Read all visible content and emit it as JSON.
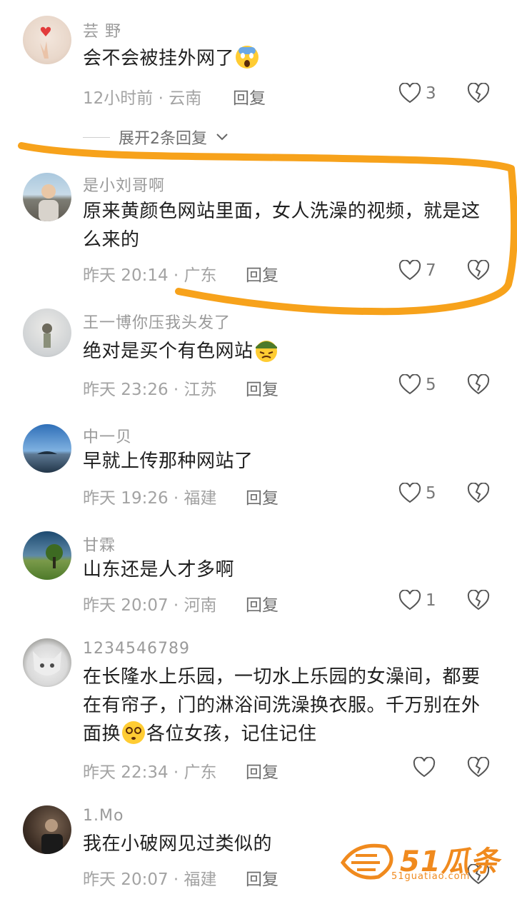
{
  "comments": [
    {
      "username": "芸 野",
      "text": "会不会被挂外网了",
      "time": "12小时前",
      "location": "云南",
      "reply": "回复",
      "likes": "3"
    },
    {
      "username": "是小刘哥啊",
      "text": "原来黄颜色网站里面，女人洗澡的视频，就是这么来的",
      "time": "昨天 20:14",
      "location": "广东",
      "reply": "回复",
      "likes": "7"
    },
    {
      "username": "王一博你压我头发了",
      "text": "绝对是买个有色网站",
      "time": "昨天 23:26",
      "location": "江苏",
      "reply": "回复",
      "likes": "5"
    },
    {
      "username": "中一贝",
      "text": "早就上传那种网站了",
      "time": "昨天 19:26",
      "location": "福建",
      "reply": "回复",
      "likes": "5"
    },
    {
      "username": "甘霖",
      "text": "山东还是人才多啊",
      "time": "昨天 20:07",
      "location": "河南",
      "reply": "回复",
      "likes": "1"
    },
    {
      "username": "1234546789",
      "text_a": "在长隆水上乐园，一切水上乐园的女澡间，都要在有帘子，门的淋浴间洗澡换衣服。千万别在外面换",
      "text_b": "各位女孩，记住记住",
      "time": "昨天 22:34",
      "location": "广东",
      "reply": "回复",
      "likes": ""
    },
    {
      "username": "1.Mo",
      "text": "我在小破网见过类似的",
      "time": "昨天 20:07",
      "location": "福建",
      "reply": "回复",
      "likes": ""
    }
  ],
  "expand_replies": "展开2条回复",
  "separator": "·",
  "icons": {
    "like": "heart-outline-icon",
    "dislike": "broken-heart-icon",
    "expand": "chevron-down-icon"
  },
  "watermark": {
    "brand": "51瓜条",
    "url": "51guatiao.com"
  },
  "colors": {
    "annotation": "#f7a21b",
    "watermark": "#f08a1e"
  }
}
